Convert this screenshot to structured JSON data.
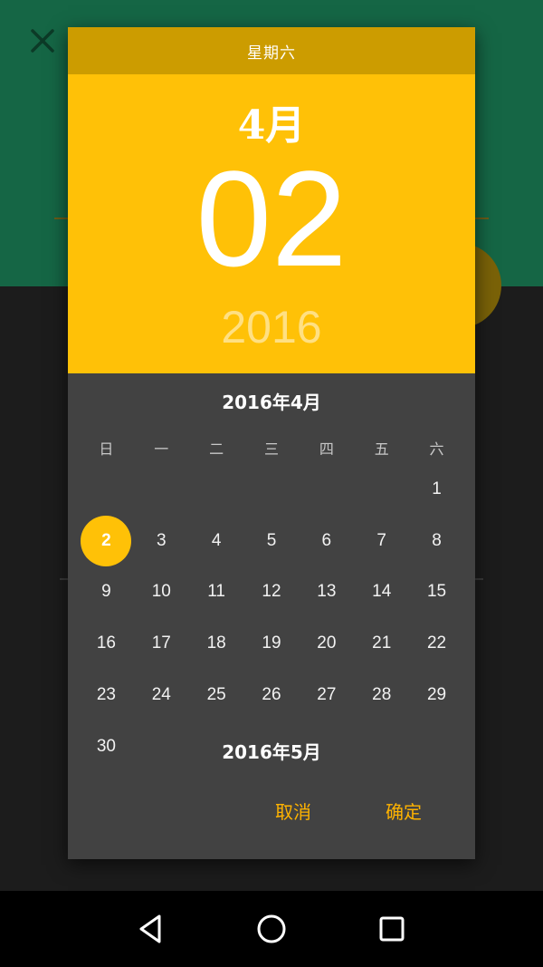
{
  "colors": {
    "accent": "#ffc107",
    "accent_dark": "#cc9c00",
    "dialog_bg": "#424242",
    "action_text": "#ffb300",
    "bg_header": "#156645"
  },
  "background": {
    "close_icon": "close-icon"
  },
  "dialog": {
    "day_of_week": "星期六",
    "header_month": "4月",
    "header_day": "02",
    "header_year": "2016",
    "current_month_title": "2016年4月",
    "next_month_title": "2016年5月",
    "weekdays": [
      "日",
      "一",
      "二",
      "三",
      "四",
      "五",
      "六"
    ],
    "first_weekday_index": 6,
    "days": [
      "1",
      "2",
      "3",
      "4",
      "5",
      "6",
      "7",
      "8",
      "9",
      "10",
      "11",
      "12",
      "13",
      "14",
      "15",
      "16",
      "17",
      "18",
      "19",
      "20",
      "21",
      "22",
      "23",
      "24",
      "25",
      "26",
      "27",
      "28",
      "29",
      "30"
    ],
    "selected_day": "2",
    "cancel_label": "取消",
    "ok_label": "确定"
  },
  "navbar": {
    "icons": [
      "back-icon",
      "home-icon",
      "recents-icon"
    ]
  }
}
